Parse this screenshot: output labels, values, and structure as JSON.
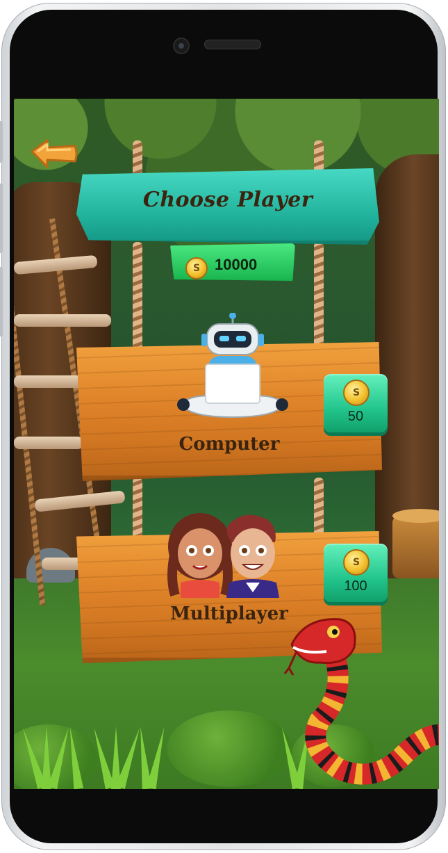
{
  "screen": {
    "title": "Choose Player",
    "coins": "10000",
    "back_icon": "arrow-left-icon"
  },
  "modes": [
    {
      "label": "Computer",
      "price": "50",
      "icon": "robot-icon"
    },
    {
      "label": "Multiplayer",
      "price": "100",
      "icon": "kids-icon"
    }
  ],
  "colors": {
    "title_plank": "#22b49d",
    "coin_panel": "#18b44c",
    "wood_plank": "#e0852a",
    "price_tag": "#23c58d",
    "text_dark": "#3a2410"
  }
}
